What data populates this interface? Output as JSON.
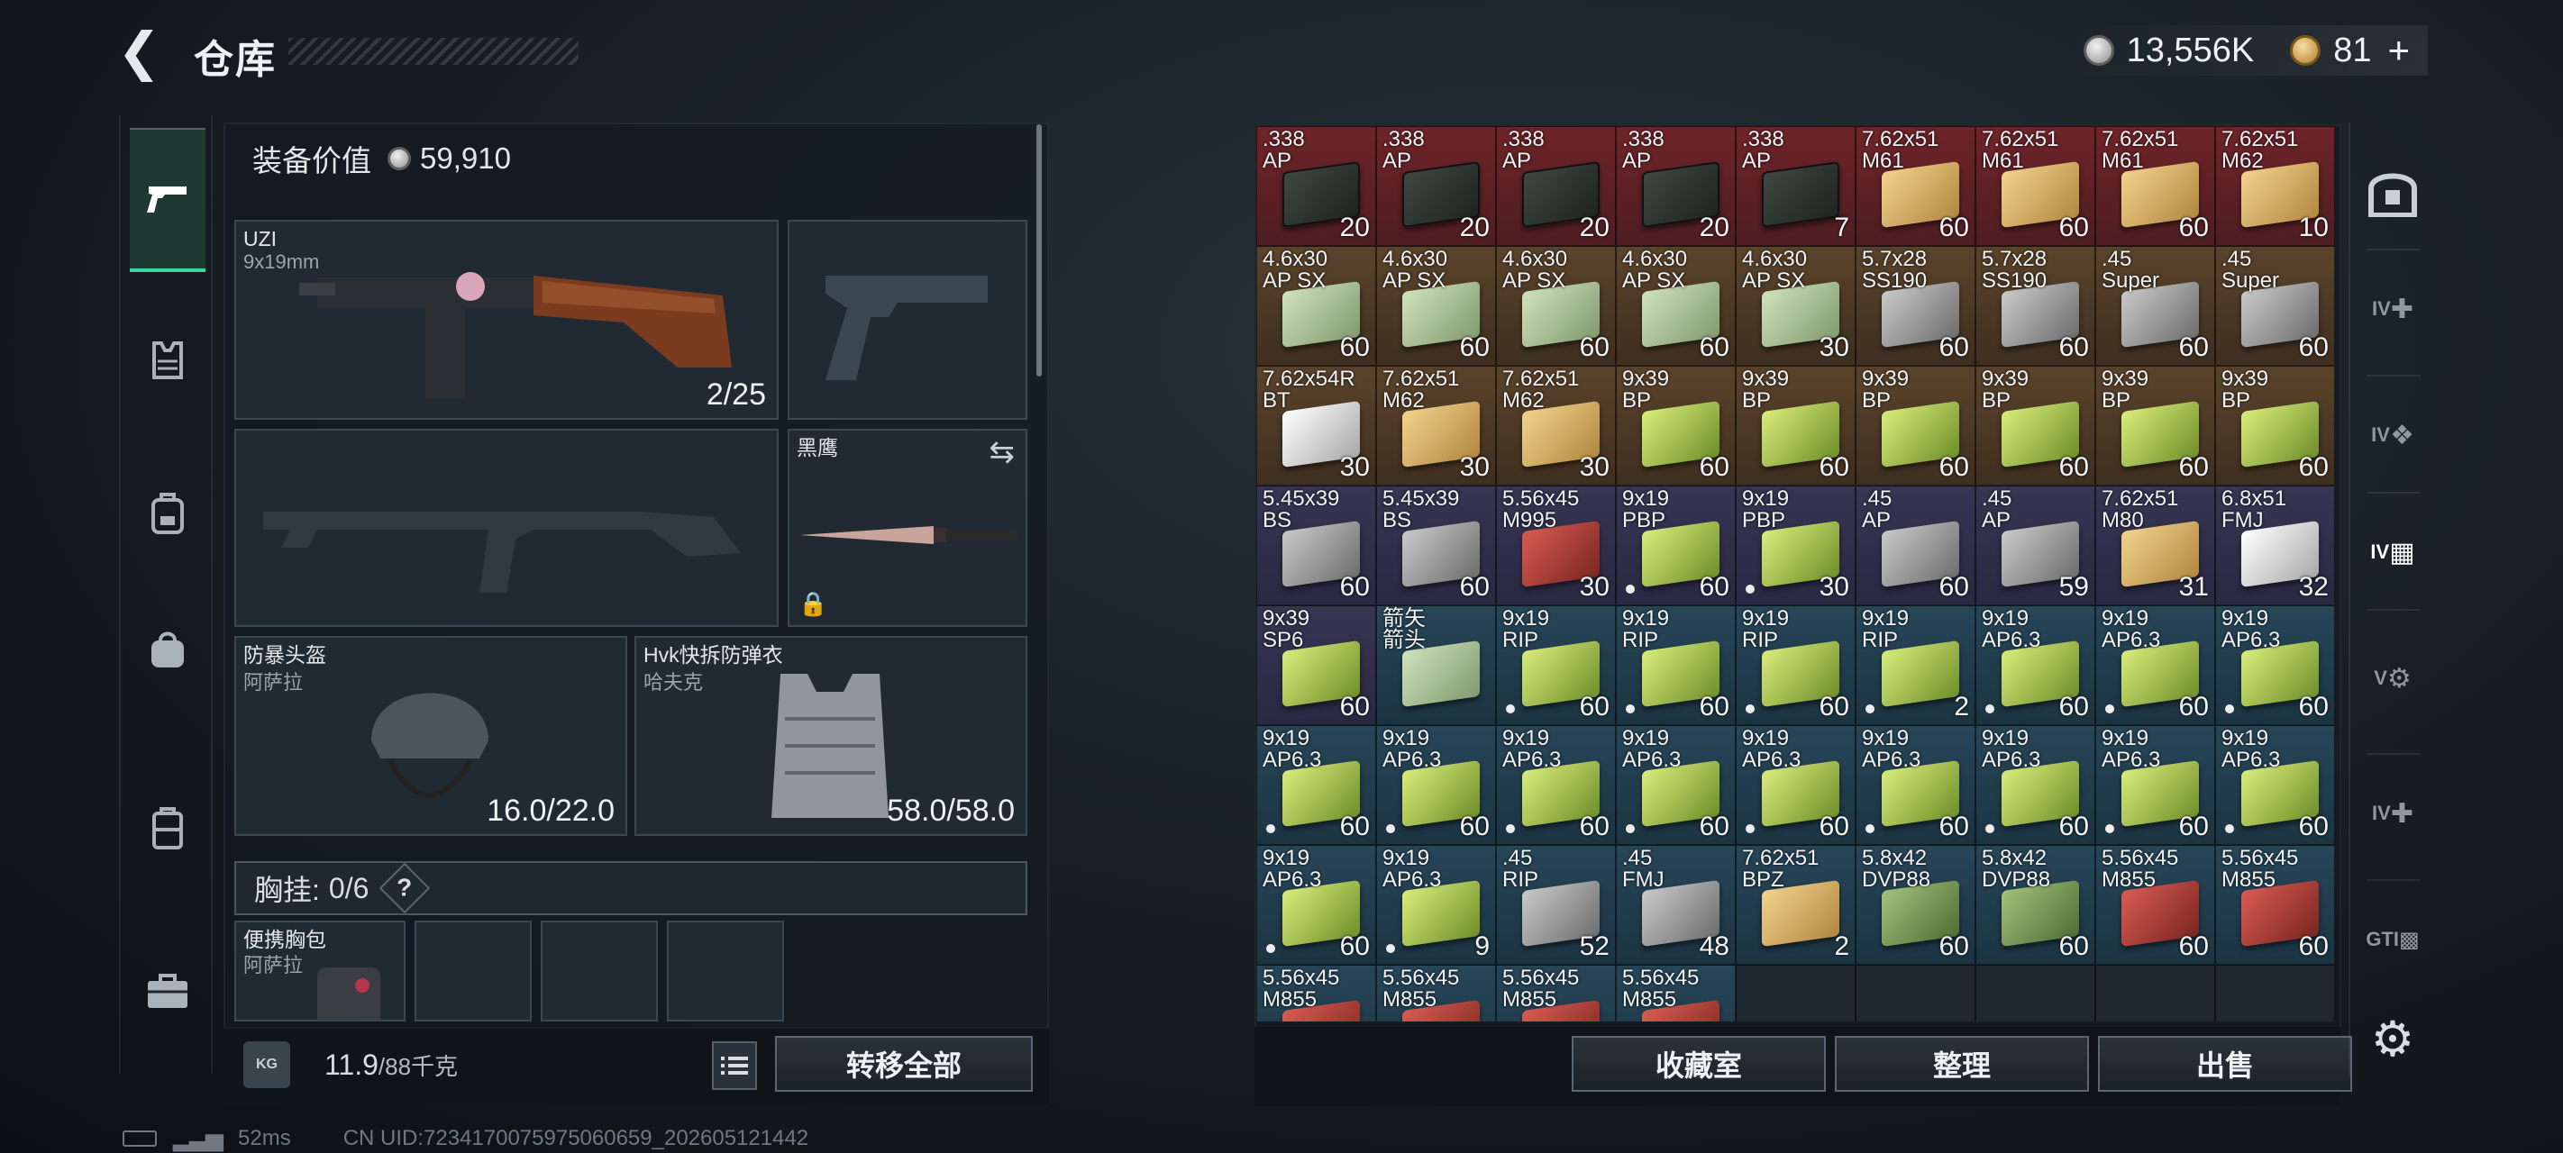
{
  "header": {
    "title": "仓库",
    "silver": "13,556K",
    "gold": "81",
    "plus": "+"
  },
  "loadout": {
    "gear_value_label": "装备价值",
    "gear_value": "59,910",
    "primary": {
      "name": "UZI",
      "caliber": "9x19mm",
      "ammo": "2/25"
    },
    "melee": {
      "name": "黑鹰"
    },
    "helmet": {
      "name": "防暴头盔",
      "maker": "阿萨拉",
      "durability": "16.0/22.0"
    },
    "armor": {
      "name": "Hvk快拆防弹衣",
      "maker": "哈夫克",
      "durability": "58.0/58.0"
    },
    "chest_label": "胸挂:",
    "chest_value": "0/6",
    "chest_help": "?",
    "bag": {
      "name": "便携胸包",
      "maker": "阿萨拉"
    }
  },
  "weight": {
    "icon_label": "KG",
    "current": "11.9",
    "max": "/88千克"
  },
  "buttons": {
    "transfer_all": "转移全部",
    "collection": "收藏室",
    "sort": "整理",
    "sell": "出售"
  },
  "status": {
    "ping": "52ms",
    "uid": "CN UID:7234170075975060659_202605121442"
  },
  "right_nav": [
    "IV",
    "IV",
    "IV",
    "V",
    "IV",
    "GTI"
  ],
  "inventory": [
    {
      "cal": ".338\nAP",
      "count": "20",
      "bg": "red",
      "box": "ammo-can"
    },
    {
      "cal": ".338\nAP",
      "count": "20",
      "bg": "red",
      "box": "ammo-can"
    },
    {
      "cal": ".338\nAP",
      "count": "20",
      "bg": "red",
      "box": "ammo-can"
    },
    {
      "cal": ".338\nAP",
      "count": "20",
      "bg": "red",
      "box": "ammo-can"
    },
    {
      "cal": ".338\nAP",
      "count": "7",
      "bg": "red",
      "box": "ammo-can"
    },
    {
      "cal": "7.62x51\nM61",
      "count": "60",
      "bg": "red",
      "box": "tan"
    },
    {
      "cal": "7.62x51\nM61",
      "count": "60",
      "bg": "red",
      "box": "tan"
    },
    {
      "cal": "7.62x51\nM61",
      "count": "60",
      "bg": "red",
      "box": "tan"
    },
    {
      "cal": "7.62x51\nM62",
      "count": "10",
      "bg": "red",
      "box": "tan"
    },
    {
      "cal": "4.6x30\nAP SX",
      "count": "60",
      "bg": "brown",
      "box": "lgreen"
    },
    {
      "cal": "4.6x30\nAP SX",
      "count": "60",
      "bg": "brown",
      "box": "lgreen"
    },
    {
      "cal": "4.6x30\nAP SX",
      "count": "60",
      "bg": "brown",
      "box": "lgreen"
    },
    {
      "cal": "4.6x30\nAP SX",
      "count": "60",
      "bg": "brown",
      "box": "lgreen"
    },
    {
      "cal": "4.6x30\nAP SX",
      "count": "30",
      "bg": "brown",
      "box": "lgreen"
    },
    {
      "cal": "5.7x28\nSS190",
      "count": "60",
      "bg": "brown",
      "box": "gray"
    },
    {
      "cal": "5.7x28\nSS190",
      "count": "60",
      "bg": "brown",
      "box": "gray"
    },
    {
      "cal": ".45\nSuper",
      "count": "60",
      "bg": "brown",
      "box": "gray"
    },
    {
      "cal": ".45\nSuper",
      "count": "60",
      "bg": "brown",
      "box": "gray"
    },
    {
      "cal": "7.62x54R\nBT",
      "count": "30",
      "bg": "brown",
      "box": "white"
    },
    {
      "cal": "7.62x51\nM62",
      "count": "30",
      "bg": "brown",
      "box": "tan"
    },
    {
      "cal": "7.62x51\nM62",
      "count": "30",
      "bg": "brown",
      "box": "tan"
    },
    {
      "cal": "9x39\nBP",
      "count": "60",
      "bg": "brown",
      "box": "green"
    },
    {
      "cal": "9x39\nBP",
      "count": "60",
      "bg": "brown",
      "box": "green"
    },
    {
      "cal": "9x39\nBP",
      "count": "60",
      "bg": "brown",
      "box": "green"
    },
    {
      "cal": "9x39\nBP",
      "count": "60",
      "bg": "brown",
      "box": "green"
    },
    {
      "cal": "9x39\nBP",
      "count": "60",
      "bg": "brown",
      "box": "green"
    },
    {
      "cal": "9x39\nBP",
      "count": "60",
      "bg": "brown",
      "box": "green"
    },
    {
      "cal": "5.45x39\nBS",
      "count": "60",
      "bg": "purple",
      "box": "gray"
    },
    {
      "cal": "5.45x39\nBS",
      "count": "60",
      "bg": "purple",
      "box": "gray"
    },
    {
      "cal": "5.56x45\nM995",
      "count": "30",
      "bg": "purple",
      "box": "red"
    },
    {
      "cal": "9x19\nPBP",
      "count": "60",
      "bg": "purple",
      "box": "green",
      "dot": true
    },
    {
      "cal": "9x19\nPBP",
      "count": "30",
      "bg": "purple",
      "box": "green",
      "dot": true
    },
    {
      "cal": ".45\nAP",
      "count": "60",
      "bg": "purple",
      "box": "gray"
    },
    {
      "cal": ".45\nAP",
      "count": "59",
      "bg": "purple",
      "box": "gray"
    },
    {
      "cal": "7.62x51\nM80",
      "count": "31",
      "bg": "purple",
      "box": "tan"
    },
    {
      "cal": "6.8x51\nFMJ",
      "count": "32",
      "bg": "purple",
      "box": "white"
    },
    {
      "cal": "9x39\nSP6",
      "count": "60",
      "bg": "purple",
      "box": "green"
    },
    {
      "cal": "箭矢\n箭头",
      "count": "",
      "bg": "blue",
      "box": "lgreen"
    },
    {
      "cal": "9x19\nRIP",
      "count": "60",
      "bg": "blue",
      "box": "green",
      "dot": true
    },
    {
      "cal": "9x19\nRIP",
      "count": "60",
      "bg": "blue",
      "box": "green",
      "dot": true
    },
    {
      "cal": "9x19\nRIP",
      "count": "60",
      "bg": "blue",
      "box": "green",
      "dot": true
    },
    {
      "cal": "9x19\nRIP",
      "count": "2",
      "bg": "blue",
      "box": "green",
      "dot": true
    },
    {
      "cal": "9x19\nAP6.3",
      "count": "60",
      "bg": "blue",
      "box": "green",
      "dot": true
    },
    {
      "cal": "9x19\nAP6.3",
      "count": "60",
      "bg": "blue",
      "box": "green",
      "dot": true
    },
    {
      "cal": "9x19\nAP6.3",
      "count": "60",
      "bg": "blue",
      "box": "green",
      "dot": true
    },
    {
      "cal": "9x19\nAP6.3",
      "count": "60",
      "bg": "blue",
      "box": "green",
      "dot": true
    },
    {
      "cal": "9x19\nAP6.3",
      "count": "60",
      "bg": "blue",
      "box": "green",
      "dot": true
    },
    {
      "cal": "9x19\nAP6.3",
      "count": "60",
      "bg": "blue",
      "box": "green",
      "dot": true
    },
    {
      "cal": "9x19\nAP6.3",
      "count": "60",
      "bg": "blue",
      "box": "green",
      "dot": true
    },
    {
      "cal": "9x19\nAP6.3",
      "count": "60",
      "bg": "blue",
      "box": "green",
      "dot": true
    },
    {
      "cal": "9x19\nAP6.3",
      "count": "60",
      "bg": "blue",
      "box": "green",
      "dot": true
    },
    {
      "cal": "9x19\nAP6.3",
      "count": "60",
      "bg": "blue",
      "box": "green",
      "dot": true
    },
    {
      "cal": "9x19\nAP6.3",
      "count": "60",
      "bg": "blue",
      "box": "green",
      "dot": true
    },
    {
      "cal": "9x19\nAP6.3",
      "count": "60",
      "bg": "blue",
      "box": "green",
      "dot": true
    },
    {
      "cal": "9x19\nAP6.3",
      "count": "60",
      "bg": "blue",
      "box": "green",
      "dot": true
    },
    {
      "cal": "9x19\nAP6.3",
      "count": "9",
      "bg": "blue",
      "box": "green",
      "dot": true
    },
    {
      "cal": ".45\nRIP",
      "count": "52",
      "bg": "blue",
      "box": "gray"
    },
    {
      "cal": ".45\nFMJ",
      "count": "48",
      "bg": "blue",
      "box": "gray"
    },
    {
      "cal": "7.62x51\nBPZ",
      "count": "2",
      "bg": "blue",
      "box": "tan"
    },
    {
      "cal": "5.8x42\nDVP88",
      "count": "60",
      "bg": "blue",
      "box": "dkgreen"
    },
    {
      "cal": "5.8x42\nDVP88",
      "count": "60",
      "bg": "blue",
      "box": "dkgreen"
    },
    {
      "cal": "5.56x45\nM855",
      "count": "60",
      "bg": "blue",
      "box": "red"
    },
    {
      "cal": "5.56x45\nM855",
      "count": "60",
      "bg": "blue",
      "box": "red"
    },
    {
      "cal": "5.56x45\nM855",
      "count": "",
      "bg": "blue",
      "box": "red"
    },
    {
      "cal": "5.56x45\nM855",
      "count": "",
      "bg": "blue",
      "box": "red"
    },
    {
      "cal": "5.56x45\nM855",
      "count": "",
      "bg": "blue",
      "box": "red"
    },
    {
      "cal": "5.56x45\nM855",
      "count": "",
      "bg": "blue",
      "box": "red"
    }
  ]
}
